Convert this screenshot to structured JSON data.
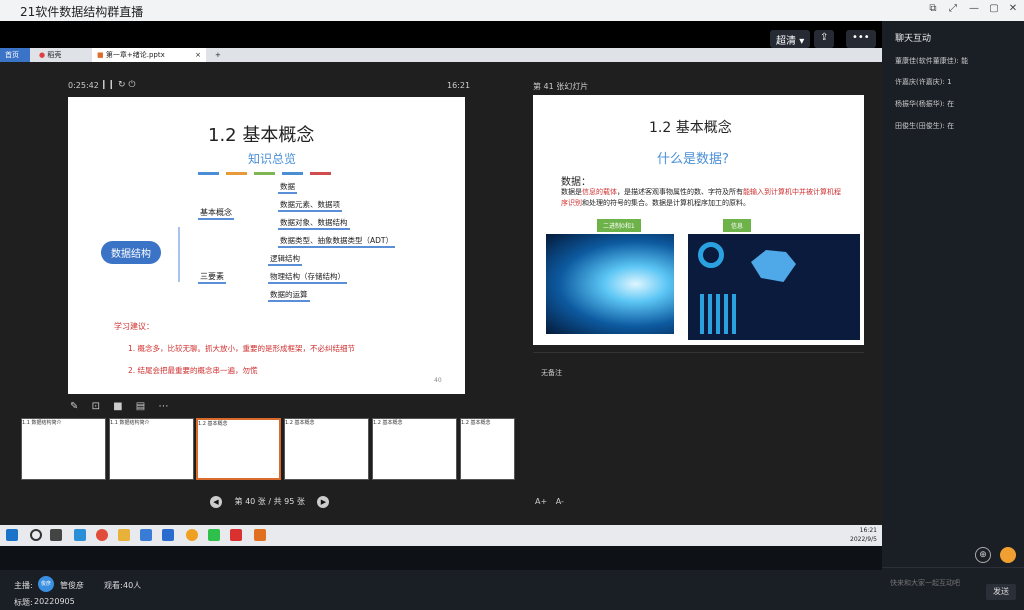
{
  "window": {
    "title": "21软件数据结构群直播"
  },
  "top_controls": {
    "quality": "超清",
    "more": "•••"
  },
  "browser": {
    "tabs": [
      "首页",
      "稻壳",
      "第一章+绪论.pptx"
    ],
    "new_tab": "+"
  },
  "ppt": {
    "timer": "0:25:42",
    "clock": "16:21",
    "next_label": "第 41 张幻灯片",
    "no_notes": "无备注",
    "pager": "第 40 张 / 共 95 张",
    "main_slide": {
      "title": "1.2  基本概念",
      "subtitle": "知识总览",
      "root": "数据结构",
      "branch1": "基本概念",
      "branch1_items": [
        "数据",
        "数据元素、数据项",
        "数据对象、数据结构",
        "数据类型、抽象数据类型（ADT）"
      ],
      "branch2": "三要素",
      "branch2_items": [
        "逻辑结构",
        "物理结构（存储结构）",
        "数据的运算"
      ],
      "advice_title": "学习建议：",
      "advice": [
        "1. 概念多，比较无聊。抓大放小，重要的是形成框架，不必纠结细节",
        "2. 结尾会把最重要的概念串一遍，勿慌"
      ],
      "page_no": "40"
    },
    "next_slide": {
      "title": "1.2  基本概念",
      "subtitle": "什么是数据?",
      "label": "数据：",
      "text_a": "数据是",
      "text_red1": "信息的载体",
      "text_b": "，是描述客观事物属性的数、字符及所有",
      "text_red2": "能输入到计算机中并被计算机程序识别",
      "text_c": "和处理的符号的集合。数据是计算机程序加工的原料。",
      "tag1": "二进制0和1",
      "tag2": "信息"
    },
    "thumbs": [
      "1.1 数据结构简介",
      "1.1 数据结构简介",
      "1.2 基本概念",
      "1.2 基本概念",
      "1.2 基本概念",
      "1.2 基本概念"
    ],
    "font_buttons": [
      "A+",
      "A-"
    ]
  },
  "taskbar": {
    "time": "16:21",
    "date": "2022/9/5"
  },
  "chat": {
    "title": "聊天互动",
    "messages": [
      {
        "name": "董康佳(软件董康佳):",
        "text": "能"
      },
      {
        "name": "许嘉庆(许嘉庆):",
        "text": "1"
      },
      {
        "name": "杨振华(杨振华):",
        "text": "在"
      },
      {
        "name": "田俊生(田俊生):",
        "text": "在"
      }
    ],
    "input_placeholder": "快来和大家一起互动吧",
    "send": "发送"
  },
  "footer": {
    "host_label": "主播:",
    "host_name": "管俊彦",
    "avatar_text": "俊彦",
    "viewers_label": "观看:",
    "viewers": "40人",
    "title_label": "标题:",
    "title": "20220905"
  }
}
